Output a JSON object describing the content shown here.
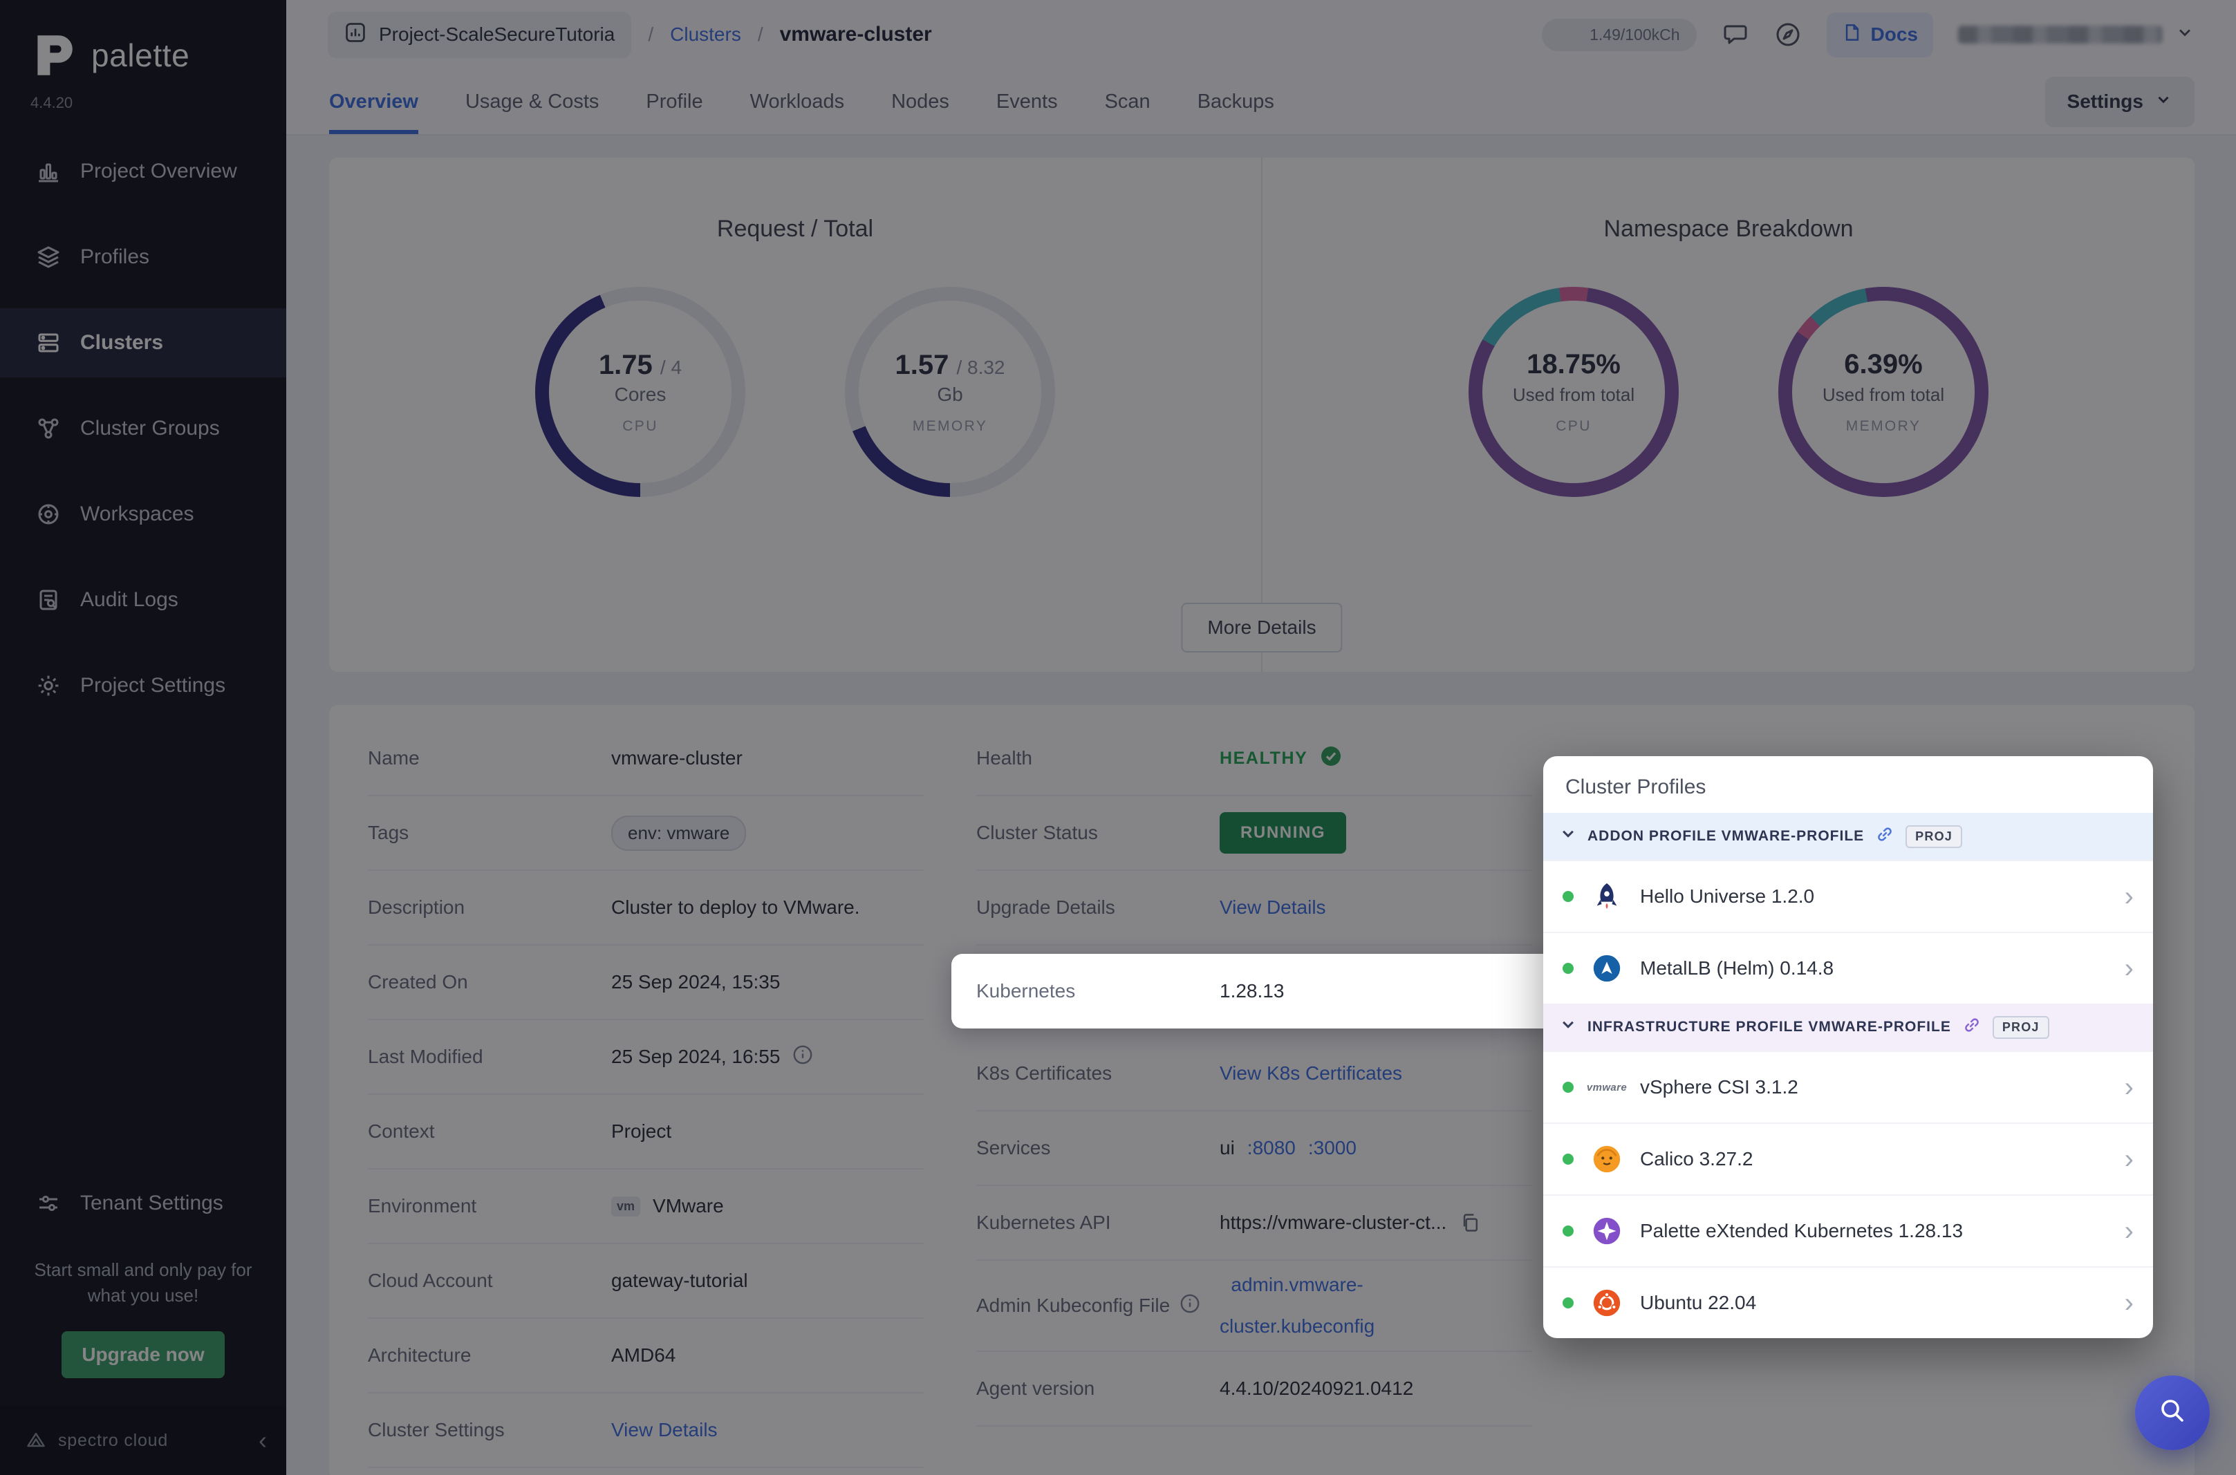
{
  "sidebar": {
    "brand": "palette",
    "version": "4.4.20",
    "items": [
      {
        "label": "Project Overview",
        "icon": "project-overview-icon",
        "active": false
      },
      {
        "label": "Profiles",
        "icon": "profiles-icon",
        "active": false
      },
      {
        "label": "Clusters",
        "icon": "clusters-icon",
        "active": true
      },
      {
        "label": "Cluster Groups",
        "icon": "cluster-groups-icon",
        "active": false
      },
      {
        "label": "Workspaces",
        "icon": "workspaces-icon",
        "active": false
      },
      {
        "label": "Audit Logs",
        "icon": "audit-logs-icon",
        "active": false
      },
      {
        "label": "Project Settings",
        "icon": "project-settings-icon",
        "active": false
      }
    ],
    "tenant_settings_label": "Tenant Settings",
    "promo_text": "Start small and only pay for what you use!",
    "upgrade_label": "Upgrade now",
    "footer_brand": "spectro cloud"
  },
  "header": {
    "project_name": "Project-ScaleSecureTutoria",
    "separator": "/",
    "breadcrumb_section": "Clusters",
    "cluster_name": "vmware-cluster",
    "usage_text": "1.49/100kCh",
    "docs_label": "Docs"
  },
  "tabs": {
    "items": [
      "Overview",
      "Usage & Costs",
      "Profile",
      "Workloads",
      "Nodes",
      "Events",
      "Scan",
      "Backups"
    ],
    "active": "Overview",
    "settings_label": "Settings"
  },
  "overview": {
    "request_total_title": "Request / Total",
    "namespace_title": "Namespace Breakdown",
    "more_details_label": "More Details",
    "cpu_gauge": {
      "value": "1.75",
      "total": "/ 4",
      "unit": "Cores",
      "caption": "CPU"
    },
    "memory_gauge": {
      "value": "1.57",
      "total": "/ 8.32",
      "unit": "Gb",
      "caption": "MEMORY"
    },
    "ns_cpu": {
      "pct": "18.75%",
      "sub": "Used from total",
      "caption": "CPU"
    },
    "ns_memory": {
      "pct": "6.39%",
      "sub": "Used from total",
      "caption": "MEMORY"
    }
  },
  "chart_data": [
    {
      "type": "pie",
      "title": "Request / Total — CPU",
      "labels": [
        "used cores",
        "free cores"
      ],
      "values": [
        1.75,
        2.25
      ],
      "annotations": [
        "1.75 / 4 Cores",
        "CPU"
      ]
    },
    {
      "type": "pie",
      "title": "Request / Total — Memory",
      "labels": [
        "used Gb",
        "free Gb"
      ],
      "values": [
        1.57,
        6.75
      ],
      "annotations": [
        "1.57 / 8.32 Gb",
        "MEMORY"
      ]
    },
    {
      "type": "pie",
      "title": "Namespace Breakdown — CPU",
      "labels": [
        "used %",
        "free %"
      ],
      "values": [
        18.75,
        81.25
      ],
      "annotations": [
        "18.75% Used from total CPU"
      ]
    },
    {
      "type": "pie",
      "title": "Namespace Breakdown — Memory",
      "labels": [
        "used %",
        "free %"
      ],
      "values": [
        6.39,
        93.61
      ],
      "annotations": [
        "6.39% Used from total MEMORY"
      ]
    }
  ],
  "details": {
    "env_chip": "vm",
    "left": [
      {
        "label": "Name",
        "value": "vmware-cluster"
      },
      {
        "label": "Tags",
        "value": "env: vmware"
      },
      {
        "label": "Description",
        "value": "Cluster to deploy to VMware."
      },
      {
        "label": "Created On",
        "value": "25 Sep 2024, 15:35"
      },
      {
        "label": "Last Modified",
        "value": "25 Sep 2024, 16:55"
      },
      {
        "label": "Context",
        "value": "Project"
      },
      {
        "label": "Environment",
        "value": "VMware"
      },
      {
        "label": "Cloud Account",
        "value": "gateway-tutorial"
      },
      {
        "label": "Architecture",
        "value": "AMD64"
      },
      {
        "label": "Cluster Settings",
        "value": "View Details"
      }
    ],
    "right": [
      {
        "label": "Health",
        "value": "HEALTHY"
      },
      {
        "label": "Cluster Status",
        "value": "RUNNING"
      },
      {
        "label": "Upgrade Details",
        "value": "View Details"
      },
      {
        "label": "Kubernetes",
        "value": "1.28.13"
      },
      {
        "label": "K8s Certificates",
        "value": "View K8s Certificates"
      },
      {
        "label": "Services",
        "value": "ui",
        "ports": [
          ":8080",
          ":3000"
        ]
      },
      {
        "label": "Kubernetes API",
        "value": "https://vmware-cluster-ct..."
      },
      {
        "label": "Admin Kubeconfig File",
        "value_lines": [
          "admin.vmware-",
          "cluster.kubeconfig"
        ]
      },
      {
        "label": "Agent version",
        "value": "4.4.10/20240921.0412"
      }
    ]
  },
  "cluster_profiles": {
    "title": "Cluster Profiles",
    "badge": "PROJ",
    "sections": [
      {
        "header": "ADDON PROFILE VMWARE-PROFILE",
        "items": [
          {
            "name": "Hello Universe 1.2.0",
            "icon": "hello-universe-icon"
          },
          {
            "name": "MetalLB (Helm) 0.14.8",
            "icon": "metallb-icon"
          }
        ]
      },
      {
        "header": "INFRASTRUCTURE PROFILE VMWARE-PROFILE",
        "items": [
          {
            "name": "vSphere CSI 3.1.2",
            "icon": "vsphere-csi-icon",
            "icon_text": "vmware"
          },
          {
            "name": "Calico 3.27.2",
            "icon": "calico-icon"
          },
          {
            "name": "Palette eXtended Kubernetes 1.28.13",
            "icon": "pxk-icon"
          },
          {
            "name": "Ubuntu 22.04",
            "icon": "ubuntu-icon"
          }
        ]
      }
    ]
  },
  "colors": {
    "accent_blue": "#3d6ee0",
    "status_green": "#2e9e5b",
    "gauge_indigo": "#332e81",
    "ring_purple": "#7e57a5",
    "ring_teal": "#49b8c4",
    "ring_pink": "#d9679f",
    "addon_header_bg": "#e7f0fb",
    "infra_header_bg": "#f4eefb",
    "fab_indigo": "#4650c0"
  }
}
